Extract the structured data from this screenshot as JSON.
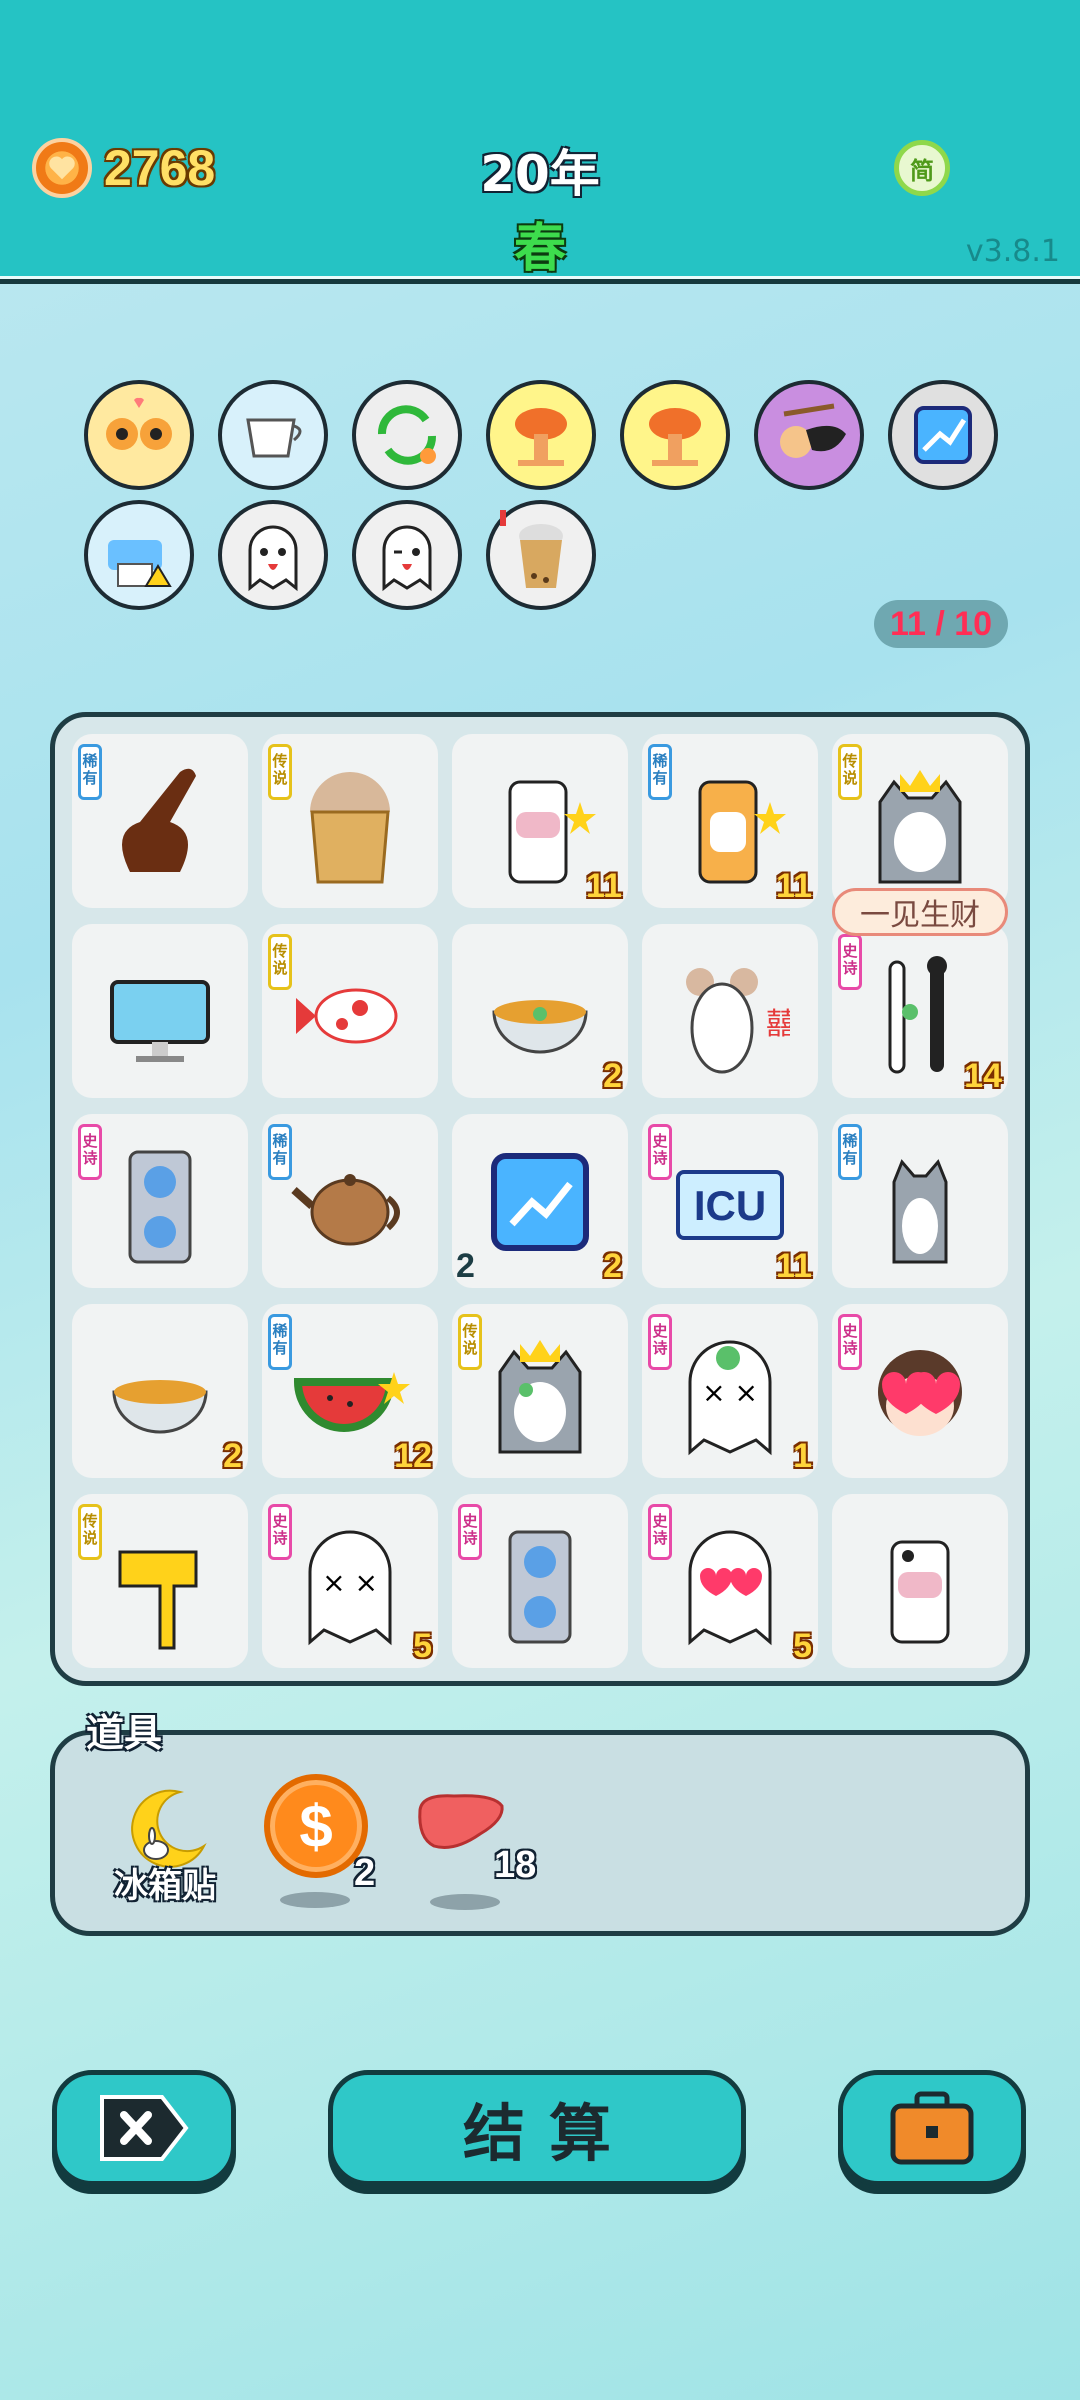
{
  "header": {
    "coins": "2768",
    "year": "20年",
    "season": "春",
    "lang_button": "简",
    "version": "v3.8.1"
  },
  "relics": {
    "counter": "11 / 10",
    "items": [
      {
        "name": "twin-cats-icon",
        "bg": "#ffe9a0"
      },
      {
        "name": "milk-jug-icon",
        "bg": "#d8f1fb"
      },
      {
        "name": "recycle-arrows-icon",
        "bg": "#eeeeee"
      },
      {
        "name": "mushroom-cloud-icon",
        "bg": "#fff58a"
      },
      {
        "name": "mushroom-cloud-icon-2",
        "bg": "#fff58a"
      },
      {
        "name": "peach-eyepatch-icon",
        "bg": "#c98ee0"
      },
      {
        "name": "trend-chart-icon",
        "bg": "#e0e0e0"
      },
      {
        "name": "printer-warning-icon",
        "bg": "#d8f1fb"
      },
      {
        "name": "ghost-tongue-icon",
        "bg": "#f0f0f0"
      },
      {
        "name": "ghost-wink-icon",
        "bg": "#f0f0f0"
      },
      {
        "name": "bubble-tea-alert-icon",
        "bg": "#f0f0f0"
      }
    ]
  },
  "board": {
    "tooltip": "一见生财",
    "cells": [
      {
        "icon": "pointing-hand-icon",
        "tag": "稀有",
        "tagType": "rare",
        "count": ""
      },
      {
        "icon": "bubble-tea-cup-icon",
        "tag": "传说",
        "tagType": "legend",
        "count": ""
      },
      {
        "icon": "cow-star-icon",
        "tag": "",
        "tagType": "",
        "count": "11"
      },
      {
        "icon": "tiger-star-icon",
        "tag": "稀有",
        "tagType": "rare",
        "count": "11"
      },
      {
        "icon": "husky-king-icon",
        "tag": "传说",
        "tagType": "legend",
        "count": ""
      },
      {
        "icon": "computer-monitor-icon",
        "tag": "",
        "tagType": "",
        "count": ""
      },
      {
        "icon": "koi-fish-icon",
        "tag": "传说",
        "tagType": "legend",
        "count": ""
      },
      {
        "icon": "bowl-clover-icon",
        "tag": "",
        "tagType": "",
        "count": "2"
      },
      {
        "icon": "mouse-double-happiness-icon",
        "tag": "",
        "tagType": "",
        "count": ""
      },
      {
        "icon": "flutes-icon",
        "tag": "史诗",
        "tagType": "epic",
        "count": "14"
      },
      {
        "icon": "graphics-card-icon",
        "tag": "史诗",
        "tagType": "epic",
        "count": ""
      },
      {
        "icon": "teapot-icon",
        "tag": "稀有",
        "tagType": "rare",
        "count": ""
      },
      {
        "icon": "trend-chart-icon",
        "tag": "",
        "tagType": "",
        "count": "2",
        "countLeft": "2"
      },
      {
        "icon": "icu-sign-icon",
        "tag": "史诗",
        "tagType": "epic",
        "count": "11"
      },
      {
        "icon": "husky-sitting-icon",
        "tag": "稀有",
        "tagType": "rare",
        "count": ""
      },
      {
        "icon": "empty-bowl-icon",
        "tag": "",
        "tagType": "",
        "count": "2"
      },
      {
        "icon": "watermelon-star-icon",
        "tag": "稀有",
        "tagType": "rare",
        "count": "12"
      },
      {
        "icon": "husky-king-clover-icon",
        "tag": "传说",
        "tagType": "legend",
        "count": ""
      },
      {
        "icon": "ghost-dead-clover-icon",
        "tag": "史诗",
        "tagType": "epic",
        "count": "1"
      },
      {
        "icon": "girl-heart-eyes-icon",
        "tag": "史诗",
        "tagType": "epic",
        "count": ""
      },
      {
        "icon": "yellow-hand-icon",
        "tag": "传说",
        "tagType": "legend",
        "count": ""
      },
      {
        "icon": "ghost-dead-icon",
        "tag": "史诗",
        "tagType": "epic",
        "count": "5"
      },
      {
        "icon": "graphics-card-icon-2",
        "tag": "史诗",
        "tagType": "epic",
        "count": ""
      },
      {
        "icon": "ghost-heart-eyes-icon",
        "tag": "史诗",
        "tagType": "epic",
        "count": "5"
      },
      {
        "icon": "cow-icon",
        "tag": "",
        "tagType": "",
        "count": ""
      }
    ]
  },
  "items": {
    "title": "道具",
    "fridge_label": "冰箱贴",
    "coin_count": "2",
    "liver_count": "18"
  },
  "buttons": {
    "settle": "结算"
  }
}
